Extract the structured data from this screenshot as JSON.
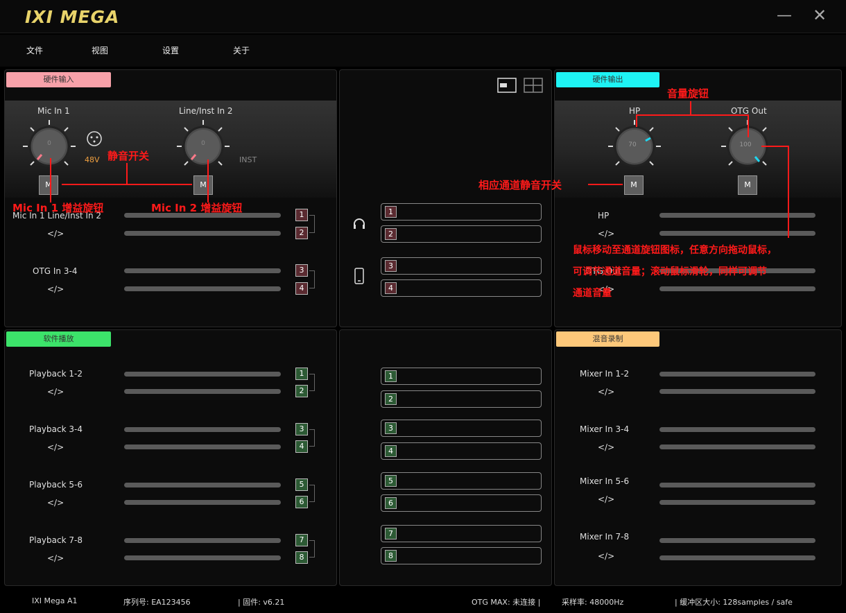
{
  "app": {
    "logo_text": "IXI MEGA",
    "minimize_glyph": "—",
    "close_glyph": "✕"
  },
  "menu": {
    "file": "文件",
    "view": "视图",
    "settings": "设置",
    "about": "关于"
  },
  "hw_input": {
    "tag": "硬件输入",
    "tag_color": "#f7a1a9",
    "knob1_label": "Mic In 1",
    "knob1_value": "0",
    "phantom": "48V",
    "knob2_label": "Line/Inst In 2",
    "knob2_value": "0",
    "inst": "INST",
    "mute_label": "M",
    "channels": [
      {
        "label": "Mic In 1  Line/Inst In 2",
        "code": "</>",
        "n1": "1",
        "n2": "2"
      },
      {
        "label": "OTG In 3-4",
        "code": "</>",
        "n1": "3",
        "n2": "4"
      }
    ]
  },
  "center_top": {
    "routes": [
      "1",
      "2",
      "3",
      "4"
    ],
    "headphone_icon": "headphone-icon",
    "phone_icon": "phone-icon"
  },
  "hw_output": {
    "tag": "硬件输出",
    "tag_color": "#1ef3f4",
    "knob1_label": "HP",
    "knob1_value": "70",
    "knob2_label": "OTG Out",
    "knob2_value": "100",
    "mute_label": "M",
    "channels": [
      {
        "label": "HP",
        "code": "</>"
      },
      {
        "label": "OTG Out",
        "code": "</>"
      }
    ]
  },
  "sw_playback": {
    "tag": "软件播放",
    "tag_color": "#3ce36a",
    "channels": [
      {
        "label": "Playback 1-2",
        "code": "</>",
        "n1": "1",
        "n2": "2"
      },
      {
        "label": "Playback 3-4",
        "code": "</>",
        "n1": "3",
        "n2": "4"
      },
      {
        "label": "Playback 5-6",
        "code": "</>",
        "n1": "5",
        "n2": "6"
      },
      {
        "label": "Playback 7-8",
        "code": "</>",
        "n1": "7",
        "n2": "8"
      }
    ]
  },
  "center_bottom": {
    "routes": [
      "1",
      "2",
      "3",
      "4",
      "5",
      "6",
      "7",
      "8"
    ]
  },
  "mix_record": {
    "tag": "混音录制",
    "tag_color": "#fdc87a",
    "channels": [
      {
        "label": "Mixer In 1-2",
        "code": "</>"
      },
      {
        "label": "Mixer In 3-4",
        "code": "</>"
      },
      {
        "label": "Mixer In 5-6",
        "code": "</>"
      },
      {
        "label": "Mixer In 7-8",
        "code": "</>"
      }
    ]
  },
  "annotations": {
    "mute_switch": "静音开关",
    "mic1_gain": "Mic In 1 增益旋钮",
    "mic2_gain": "Mic In 2 增益旋钮",
    "volume_knob": "音量旋钮",
    "channel_mute": "相应通道静音开关",
    "knob_hint_1": "鼠标移动至通道旋钮图标，任意方向拖动鼠标，",
    "knob_hint_2": "可调节通道音量；滚动鼠标滑轮，同样可调节",
    "knob_hint_3": "通道音量"
  },
  "status": {
    "device": "IXI Mega A1",
    "serial": "序列号: EA123456",
    "firmware": "| 固件: v6.21",
    "otg": "OTG MAX: 未连接 |",
    "sample_rate": "采样率: 48000Hz",
    "buffer": "| 缓冲区大小: 128samples / safe"
  }
}
